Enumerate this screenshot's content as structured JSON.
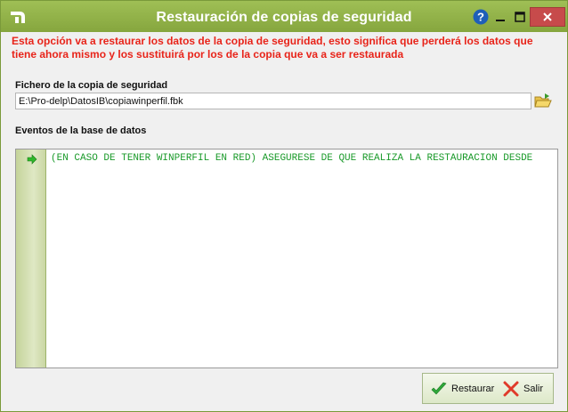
{
  "window": {
    "title": "Restauración de copias de seguridad",
    "help_label": "?"
  },
  "warning": {
    "text": "Esta opción va a restaurar los datos de la copia de seguridad, esto significa que perderá los datos que tiene ahora mismo y los sustituirá por los de la copia que va a ser restaurada"
  },
  "backup_file": {
    "label": "Fichero de la copia de seguridad",
    "value": "E:\\Pro-delp\\DatosIB\\copiawinperfil.fbk"
  },
  "events": {
    "label": "Eventos de la base de datos",
    "lines": [
      "(EN CASO DE TENER WINPERFIL EN RED) ASEGURESE DE QUE REALIZA LA RESTAURACIÓN DESDE"
    ]
  },
  "buttons": {
    "restore_label": "Restaurar",
    "exit_label": "Salir"
  },
  "colors": {
    "titlebar": "#8fae45",
    "warning_text": "#e8241a",
    "event_text": "#1a9a2a",
    "close_button": "#c74b4b"
  },
  "icons": {
    "app": "app-logo-icon",
    "help": "help-icon",
    "minimize": "minimize-icon",
    "maximize": "maximize-icon",
    "close": "close-icon",
    "folder": "open-folder-icon",
    "marker": "arrow-right-icon",
    "restore": "checkmark-icon",
    "exit": "x-icon"
  }
}
